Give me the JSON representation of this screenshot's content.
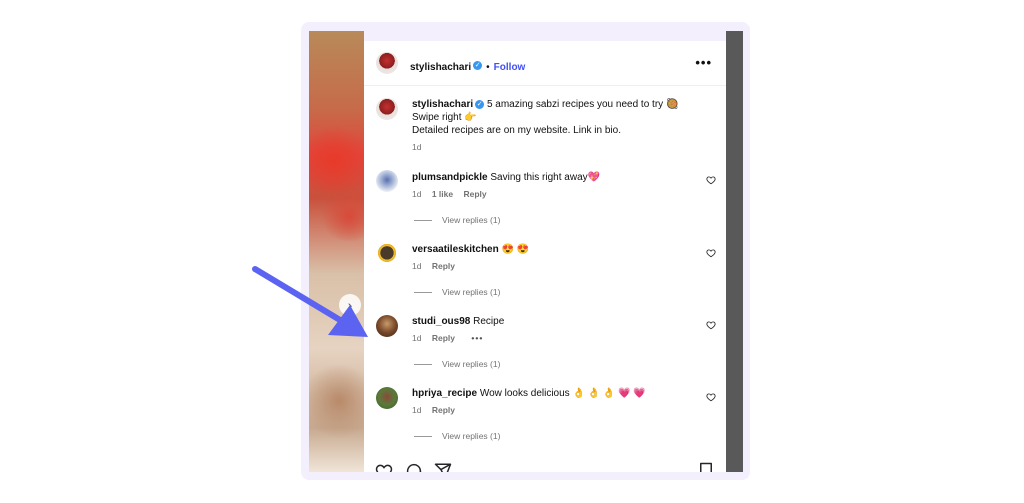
{
  "post": {
    "author": "stylishachari",
    "follow_label": "Follow",
    "separator": "•",
    "caption": {
      "author": "stylishachari",
      "line1": "5 amazing sabzi recipes you need to try",
      "line1_emoji": "🥘",
      "line2": "Swipe right",
      "line2_emoji": "👉",
      "line3": "Detailed recipes are on my website. Link in bio.",
      "time": "1d"
    },
    "more_label": "•••"
  },
  "comments": [
    {
      "user": "plumsandpickle",
      "text": "Saving this right away",
      "emoji": "💖",
      "time": "1d",
      "likes": "1 like",
      "reply": "Reply",
      "view_replies": "View replies (1)"
    },
    {
      "user": "versaatileskitchen",
      "text": "",
      "emoji": "😍 😍",
      "time": "1d",
      "reply": "Reply",
      "view_replies": "View replies (1)"
    },
    {
      "user": "studi_ous98",
      "text": "Recipe",
      "emoji": "",
      "time": "1d",
      "reply": "Reply",
      "options": "•••",
      "view_replies": "View replies (1)"
    },
    {
      "user": "hpriya_recipe",
      "text": "Wow looks delicious",
      "emoji": "👌 👌 👌 💗 💗",
      "time": "1d",
      "reply": "Reply",
      "view_replies": "View replies (1)"
    }
  ],
  "colors": {
    "accent_follow": "#4150f7",
    "annotation_arrow": "#5b63f0",
    "verified": "#3897f0"
  },
  "icons": [
    "verified-badge-icon",
    "more-options-icon",
    "heart-icon",
    "comment-icon",
    "share-icon",
    "bookmark-icon",
    "chevron-right-icon"
  ]
}
